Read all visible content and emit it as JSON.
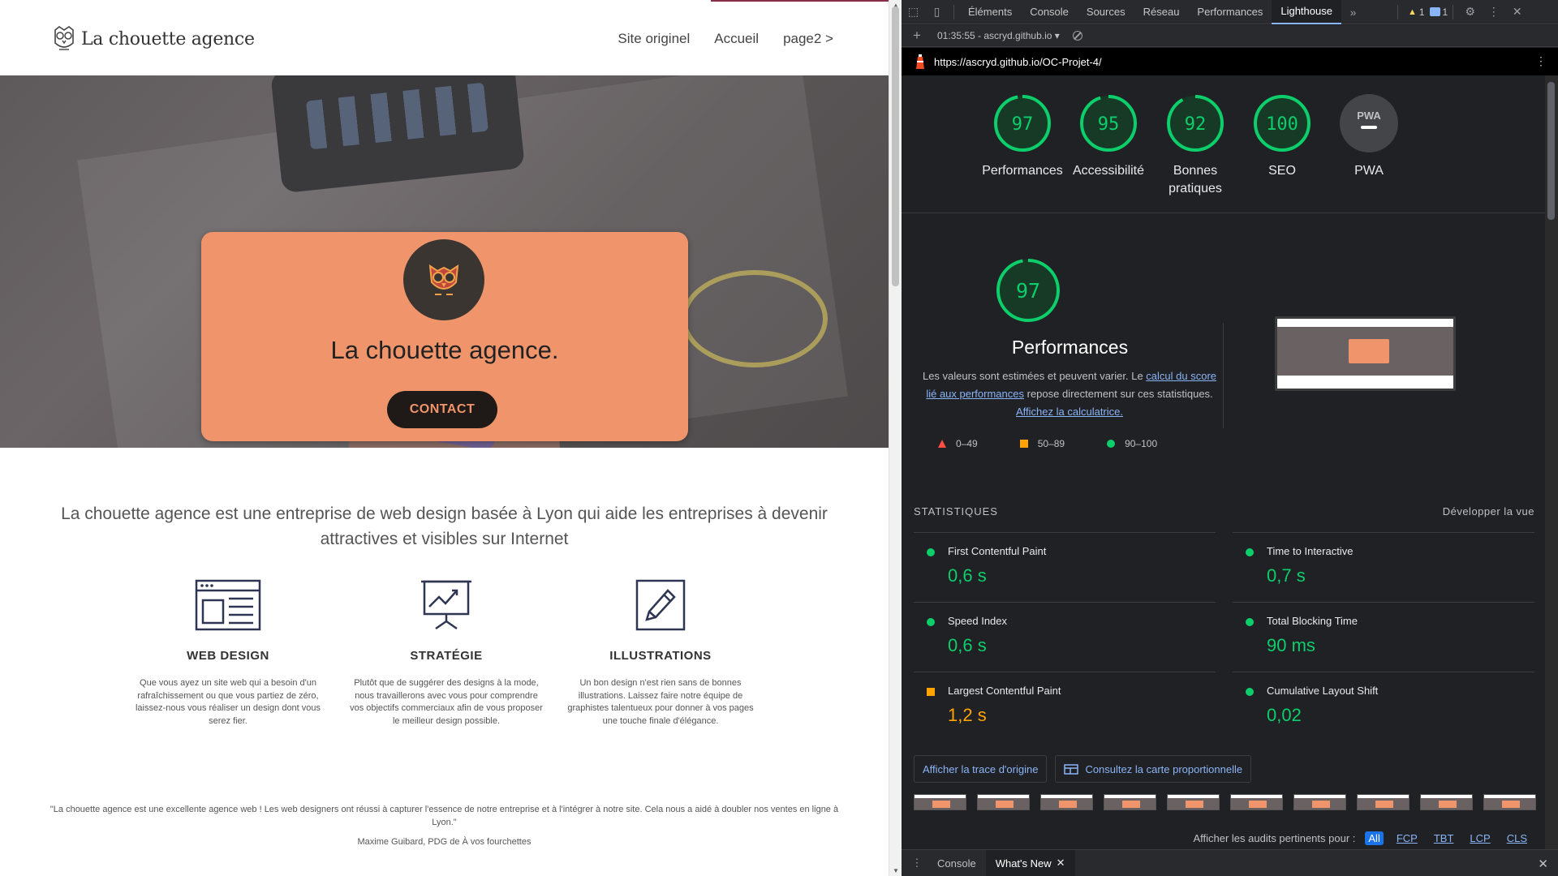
{
  "site": {
    "logo_text": "La chouette agence",
    "nav": [
      "Site originel",
      "Accueil",
      "page2 >"
    ],
    "hero_title": "La chouette agence.",
    "contact_label": "CONTACT",
    "intro": "La chouette agence est une entreprise de web design basée à Lyon qui aide les entreprises à devenir attractives et visibles sur Internet",
    "services": [
      {
        "title": "WEB DESIGN",
        "icon": "browser-window-icon",
        "desc": "Que vous ayez un site web qui a besoin d'un rafraîchissement ou que vous partiez de zéro, laissez-nous vous réaliser un design dont vous serez fier."
      },
      {
        "title": "STRATÉGIE",
        "icon": "presentation-chart-icon",
        "desc": "Plutôt que de suggérer des designs à la mode, nous travaillerons avec vous pour comprendre vos objectifs commerciaux afin de vous proposer le meilleur design possible."
      },
      {
        "title": "ILLUSTRATIONS",
        "icon": "pencil-icon",
        "desc": "Un bon design n'est rien sans de bonnes illustrations. Laissez faire notre équipe de graphistes talentueux pour donner à vos pages une touche finale d'élégance."
      }
    ],
    "testimonial": "\"La chouette agence est une excellente agence web ! Les web designers ont réussi à capturer l'essence de notre entreprise et à l'intégrer à notre site. Cela nous a aidé à doubler nos ventes en ligne à Lyon.\"",
    "author": "Maxime Guibard, PDG de À vos fourchettes",
    "colors": {
      "accent": "#f0956b",
      "dark": "#1f1a17"
    }
  },
  "devtools": {
    "tabs": [
      "Éléments",
      "Console",
      "Sources",
      "Réseau",
      "Performances",
      "Lighthouse"
    ],
    "active_tab": "Lighthouse",
    "warnings_count": "1",
    "messages_count": "1",
    "session": "01:35:55 - ascryd.github.io",
    "url": "https://ascryd.github.io/OC-Projet-4/",
    "gauges": [
      {
        "label": "Performances",
        "score": "97",
        "value": 97
      },
      {
        "label": "Accessibilité",
        "score": "95",
        "value": 95
      },
      {
        "label": "Bonnes pratiques",
        "score": "92",
        "value": 92
      },
      {
        "label": "SEO",
        "score": "100",
        "value": 100
      },
      {
        "label": "PWA",
        "score": "PWA",
        "value": 0
      }
    ],
    "perf": {
      "score": "97",
      "title": "Performances",
      "desc_1": "Les valeurs sont estimées et peuvent varier. Le ",
      "desc_link1": "calcul du score lié aux performances",
      "desc_2": " repose directement sur ces statistiques. ",
      "desc_link2": "Affichez la calculatrice.",
      "legend": [
        "0–49",
        "50–89",
        "90–100"
      ]
    },
    "stats_title": "STATISTIQUES",
    "expand_label": "Développer la vue",
    "metrics": [
      {
        "name": "First Contentful Paint",
        "value": "0,6 s",
        "status": "good"
      },
      {
        "name": "Time to Interactive",
        "value": "0,7 s",
        "status": "good"
      },
      {
        "name": "Speed Index",
        "value": "0,6 s",
        "status": "good"
      },
      {
        "name": "Total Blocking Time",
        "value": "90 ms",
        "status": "good"
      },
      {
        "name": "Largest Contentful Paint",
        "value": "1,2 s",
        "status": "average"
      },
      {
        "name": "Cumulative Layout Shift",
        "value": "0,02",
        "status": "good"
      }
    ],
    "trace_button": "Afficher la trace d'origine",
    "treemap_button": "Consultez la carte proportionnelle",
    "audits_label": "Afficher les audits pertinents pour :",
    "audit_filters": [
      "All",
      "FCP",
      "TBT",
      "LCP",
      "CLS"
    ],
    "drawer_tabs": [
      "Console",
      "What's New"
    ],
    "colors": {
      "good": "#0cce6b",
      "average": "#ffa400",
      "poor": "#ff4e42",
      "link": "#8ab4f8"
    }
  }
}
